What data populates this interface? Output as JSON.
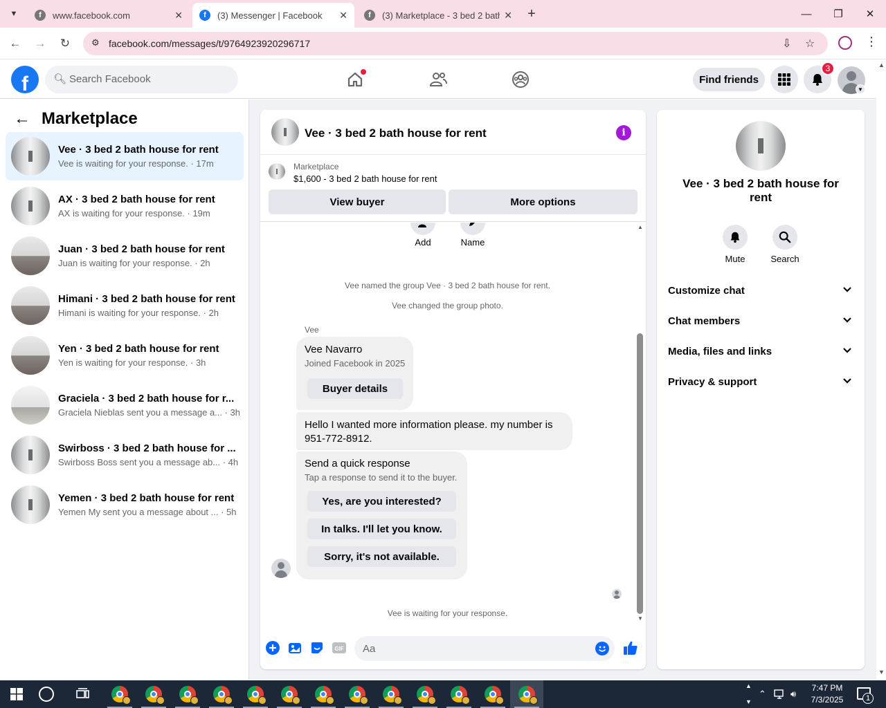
{
  "browser": {
    "tabs": [
      {
        "title": "www.facebook.com",
        "active": false
      },
      {
        "title": "(3) Messenger | Facebook",
        "active": true
      },
      {
        "title": "(3) Marketplace - 3 bed 2 bath h",
        "active": false
      }
    ],
    "url": "facebook.com/messages/t/9764923920296717"
  },
  "fb_header": {
    "search_placeholder": "Search Facebook",
    "find_friends_label": "Find friends",
    "notifications_count": "3"
  },
  "left_pane": {
    "title": "Marketplace",
    "conversations": [
      {
        "title": "Vee · 3 bed 2 bath house for rent",
        "subtitle": "Vee is waiting for your response. · 17m",
        "thumb": "hall",
        "selected": true
      },
      {
        "title": "AX · 3 bed 2 bath house for rent",
        "subtitle": "AX is waiting for your response. · 19m",
        "thumb": "hall",
        "selected": false
      },
      {
        "title": "Juan · 3 bed 2 bath house for rent",
        "subtitle": "Juan is waiting for your response. · 2h",
        "thumb": "living",
        "selected": false
      },
      {
        "title": "Himani · 3 bed 2 bath house for rent",
        "subtitle": "Himani is waiting for your response. · 2h",
        "thumb": "living",
        "selected": false
      },
      {
        "title": "Yen · 3 bed 2 bath house for rent",
        "subtitle": "Yen is waiting for your response. · 3h",
        "thumb": "living",
        "selected": false
      },
      {
        "title": "Graciela · 3 bed 2 bath house for r...",
        "subtitle": "Graciela Nieblas sent you a message a... · 3h",
        "thumb": "room",
        "selected": false
      },
      {
        "title": "Swirboss · 3 bed 2 bath house for ...",
        "subtitle": "Swirboss Boss sent you a message ab... · 4h",
        "thumb": "hall",
        "selected": false
      },
      {
        "title": "Yemen · 3 bed 2 bath house for rent",
        "subtitle": "Yemen My sent you a message about ... · 5h",
        "thumb": "hall",
        "selected": false
      }
    ]
  },
  "chat": {
    "title": "Vee · 3 bed 2 bath house for rent",
    "marketplace_label": "Marketplace",
    "listing": "$1,600 - 3 bed 2 bath house for rent",
    "view_buyer_label": "View buyer",
    "more_options_label": "More options",
    "add_label": "Add",
    "name_label": "Name",
    "system_messages": [
      "Vee named the group Vee · 3 bed 2 bath house for rent.",
      "Vee changed the group photo."
    ],
    "sender_name": "Vee",
    "buyer_card": {
      "name": "Vee Navarro",
      "joined": "Joined Facebook in 2025",
      "details_label": "Buyer details"
    },
    "message_text": "Hello I wanted more information please. my number is 951-772-8912.",
    "quick_response": {
      "title": "Send a quick response",
      "subtitle": "Tap a response to send it to the buyer.",
      "options": [
        "Yes, are you interested?",
        "In talks. I'll let you know.",
        "Sorry, it's not available."
      ]
    },
    "waiting_text": "Vee is waiting for your response.",
    "composer_placeholder": "Aa"
  },
  "right_pane": {
    "title": "Vee · 3 bed 2 bath house for rent",
    "mute_label": "Mute",
    "search_label": "Search",
    "sections": [
      "Customize chat",
      "Chat members",
      "Media, files and links",
      "Privacy & support"
    ]
  },
  "taskbar": {
    "time": "7:47 PM",
    "date": "7/3/2025",
    "notification_count": "1"
  },
  "colors": {
    "fb_blue": "#1877f2",
    "messenger_blue": "#0866ff",
    "info_purple": "#a219d8",
    "badge_red": "#e41e3f",
    "tabstrip_pink": "#f9dde7"
  }
}
